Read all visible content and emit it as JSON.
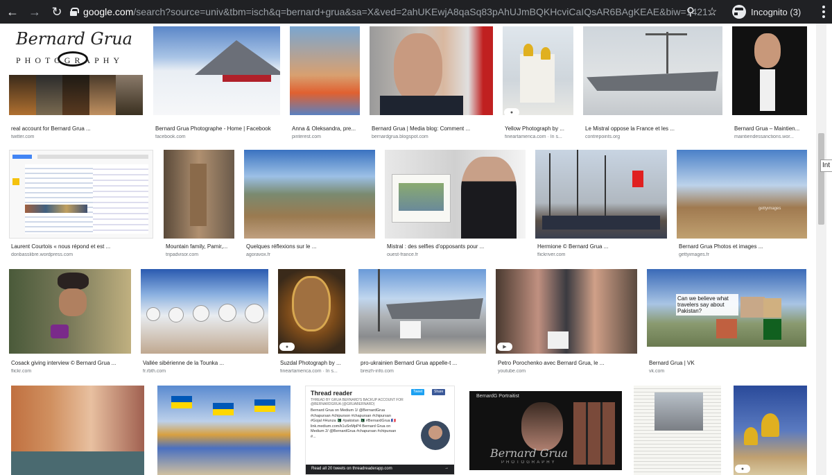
{
  "browser": {
    "url_host": "google.com",
    "url_rest": "/search?source=univ&tbm=isch&q=bernard+grua&sa=X&ved=2ahUKEwjA8qaSq83pAhUJmBQKHcviCaIQsAR6BAgKEAE&biw=1421...",
    "profile_label": "Incognito (3)"
  },
  "side_tooltip": "Int",
  "results": [
    {
      "title": "real account for Bernard Grua ...",
      "source": "twitter.com"
    },
    {
      "title": "Bernard Grua Photographe - Home | Facebook",
      "source": "facebook.com"
    },
    {
      "title": "Anna & Oleksandra, pre...",
      "source": "pinterest.com"
    },
    {
      "title": "Bernard Grua | Media blog: Comment ...",
      "source": "bernardgrua.blogspot.com"
    },
    {
      "title": "Yellow Photograph by ...",
      "source": "fineartamerica.com · In s..."
    },
    {
      "title": "Le Mistral oppose la France et les ...",
      "source": "contrepoints.org"
    },
    {
      "title": "Bernard Grua – Maintien...",
      "source": "maintiendessanctions.wor..."
    },
    {
      "title": "Laurent Courtois « nous répond et est ...",
      "source": "donbasslibre.wordpress.com"
    },
    {
      "title": "Mountain family, Pamir,...",
      "source": "tripadvisor.com"
    },
    {
      "title": "Quelques réflexions sur le ...",
      "source": "agoravox.fr"
    },
    {
      "title": "Mistral : des selfies d'opposants pour ...",
      "source": "ouest-france.fr"
    },
    {
      "title": "Hermione © Bernard Grua ...",
      "source": "flickriver.com"
    },
    {
      "title": "Bernard Grua Photos et images ...",
      "source": "gettyimages.fr"
    },
    {
      "title": "Cosack giving interview © Bernard Grua ...",
      "source": "flickr.com"
    },
    {
      "title": "Vallée sibérienne de la Tounka ...",
      "source": "fr.rbth.com"
    },
    {
      "title": "Suzdal Photograph by ...",
      "source": "fineartamerica.com · In s..."
    },
    {
      "title": "pro-ukrainien Bernard Grua appelle-t ...",
      "source": "breizh-info.com"
    },
    {
      "title": "Petro Porochenko avec Bernard Grua, le ...",
      "source": "youtube.com"
    },
    {
      "title": "Bernard Grua | VK",
      "source": "vk.com"
    }
  ],
  "image_text": {
    "logo_title": "Bernard Grua",
    "logo_sub": "PHOTOGRAPHY",
    "gettyimages": "gettyimages",
    "pakistan_question": "Can we believe what travelers say about Pakistan?",
    "thread_title": "Thread reader",
    "thread_sub": "THREAD BY GRUA BERNARD'S BACKUP ACCOUNT FOR @BERNARDGRUA (@GRUABERNARD)",
    "thread_body": "Bernard Grua on Medium 1/ @BernardGrua\n#chapursan #chipurson #chapursan #chipursan\n#Gojal #Hunza 🇵🇰 #pakistan 🇵🇰 #BernardGrua 🇫🇷\nlink.medium.com/k1uSnMpP4 Bernard Grua on\nMedium 2/ @BernardGrua #chapursan #chipursan\n#...",
    "thread_footer": "Read all 20 tweets on threadreaderapp.com",
    "tweet_btn": "Tweet",
    "share_btn": "Share",
    "portraitist_title": "BernardG Portraitist",
    "portraitist_logo": "Bernard Grua",
    "portraitist_sub": "PHOTOGRAPHY"
  },
  "colors": {
    "chrome_bar": "#202124",
    "caption_text": "#222222",
    "source_text": "#70757a"
  }
}
